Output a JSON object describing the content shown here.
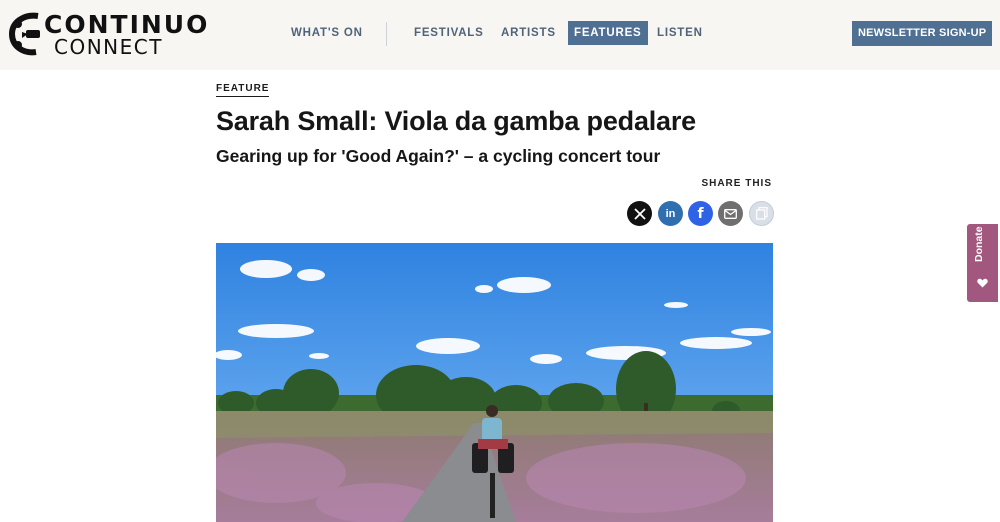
{
  "brand": {
    "line1": "CONTINUO",
    "line2": "CONNECT"
  },
  "nav": {
    "items": [
      {
        "label": "WHAT'S ON"
      },
      {
        "label": "FESTIVALS"
      },
      {
        "label": "ARTISTS"
      },
      {
        "label": "FEATURES",
        "active": true
      },
      {
        "label": "LISTEN"
      }
    ],
    "newsletter_label": "NEWSLETTER SIGN-UP"
  },
  "article": {
    "kicker": "FEATURE",
    "title": "Sarah Small: Viola da gamba pedalare",
    "subtitle": "Gearing up for 'Good Again?' – a cycling concert tour",
    "share_label": "SHARE THIS",
    "share_buttons": [
      {
        "icon": "x-icon",
        "glyph": "X",
        "color": "#111111"
      },
      {
        "icon": "linkedin-icon",
        "glyph": "in",
        "color": "#2f6fb0"
      },
      {
        "icon": "facebook-icon",
        "glyph": "f",
        "color": "#2f63e6"
      },
      {
        "icon": "email-icon",
        "glyph": "✉",
        "color": "#6f6f6f"
      },
      {
        "icon": "copy-link-icon",
        "glyph": "⧉",
        "color": "#cdd5dd"
      }
    ]
  },
  "donate_label": "Donate",
  "colors": {
    "nav_text": "#4f6479",
    "accent": "#4f7092",
    "donate": "#a2577e",
    "header_bg": "#f7f6f2"
  }
}
